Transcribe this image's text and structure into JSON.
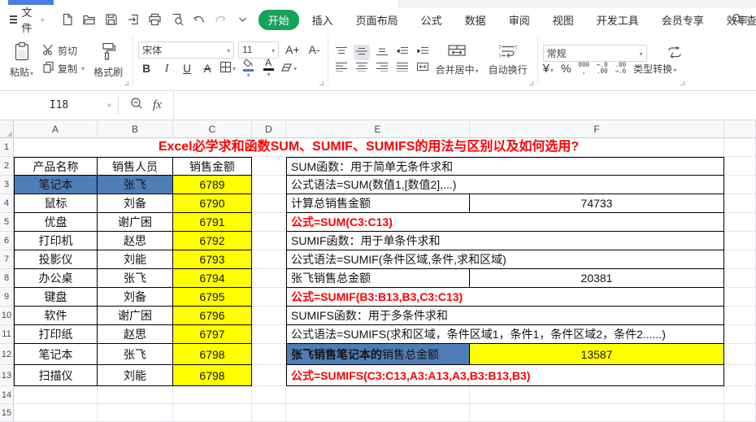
{
  "menu": {
    "file_label": "文件",
    "quick_icons": [
      "new-file",
      "open-folder",
      "save",
      "export",
      "print",
      "print-preview",
      "undo",
      "redo",
      "more"
    ],
    "tabs": [
      {
        "id": "home",
        "label": "开始",
        "active": true
      },
      {
        "id": "insert",
        "label": "插入"
      },
      {
        "id": "page-layout",
        "label": "页面布局"
      },
      {
        "id": "formulas",
        "label": "公式"
      },
      {
        "id": "data",
        "label": "数据"
      },
      {
        "id": "review",
        "label": "审阅"
      },
      {
        "id": "view",
        "label": "视图"
      },
      {
        "id": "dev-tools",
        "label": "开发工具"
      },
      {
        "id": "member",
        "label": "会员专享"
      },
      {
        "id": "efficiency",
        "label": "效率"
      }
    ],
    "search_label": "查找"
  },
  "ribbon": {
    "paste_label": "粘贴",
    "cut_label": "剪切",
    "copy_label": "复制",
    "format_painter_label": "格式刷",
    "font_name": "宋体",
    "font_size": "11",
    "grow_font_label": "A+",
    "shrink_font_label": "A-",
    "bold_label": "B",
    "italic_label": "I",
    "underline_label": "U",
    "strikethrough_label": "A",
    "font_color_label": "A",
    "merge_center_label": "合并居中",
    "wrap_label": "自动换行",
    "number_format": "常规",
    "currency_label": "¥",
    "percent_label": "%",
    "thousands_top": "000",
    "thousands_bottom": ",",
    "dec_decimal_top": "←.0",
    "dec_decimal_bottom": ".00",
    "inc_decimal_top": ".00",
    "inc_decimal_bottom": "→.0",
    "type_convert_label": "类型转换"
  },
  "formula_bar": {
    "name_box": "I18",
    "fx_label": "fx",
    "formula_value": ""
  },
  "sheet": {
    "title": "Excel必学求和函数SUM、SUMIF、SUMIFS的用法与区别以及如何选用?",
    "col_headers": [
      "A",
      "B",
      "C",
      "D",
      "E",
      "F"
    ],
    "rows": [
      {
        "num": 1,
        "type": "title"
      },
      {
        "num": 2,
        "left": [
          "产品名称",
          "销售人员",
          "销售金额"
        ],
        "left_type": "header",
        "right": {
          "kind": "full",
          "text": "SUM函数：用于简单无条件求和"
        }
      },
      {
        "num": 3,
        "left": [
          "笔记本",
          "张飞",
          "6789"
        ],
        "selected": true,
        "right": {
          "kind": "full",
          "text": "公式语法=SUM(数值1,[数值2],...)"
        }
      },
      {
        "num": 4,
        "left": [
          "鼠标",
          "刘备",
          "6790"
        ],
        "right": {
          "kind": "split",
          "label": "计算总销售金额",
          "value": "74733"
        }
      },
      {
        "num": 5,
        "left": [
          "优盘",
          "谢广困",
          "6791"
        ],
        "right": {
          "kind": "formula",
          "text": "公式=SUM(C3:C13)"
        }
      },
      {
        "num": 6,
        "left": [
          "打印机",
          "赵思",
          "6792"
        ],
        "right": {
          "kind": "full",
          "text": "SUMIF函数：用于单条件求和"
        }
      },
      {
        "num": 7,
        "left": [
          "投影仪",
          "刘能",
          "6793"
        ],
        "right": {
          "kind": "full",
          "text": "公式语法=SUMIF(条件区域,条件,求和区域)"
        }
      },
      {
        "num": 8,
        "left": [
          "办公桌",
          "张飞",
          "6794"
        ],
        "right": {
          "kind": "split",
          "label": "张飞销售总金额",
          "value": "20381"
        }
      },
      {
        "num": 9,
        "left": [
          "键盘",
          "刘备",
          "6795"
        ],
        "right": {
          "kind": "formula",
          "text": "公式=SUMIF(B3:B13,B3,C3:C13)"
        }
      },
      {
        "num": 10,
        "left": [
          "软件",
          "谢广困",
          "6796"
        ],
        "right": {
          "kind": "full",
          "text": "SUMIFS函数：用于多条件求和"
        }
      },
      {
        "num": 11,
        "left": [
          "打印纸",
          "赵思",
          "6797"
        ],
        "right": {
          "kind": "full",
          "text": "公式语法=SUMIFS(求和区域，条件区域1，条件1，条件区域2，条件2......)"
        }
      },
      {
        "num": 12,
        "left": [
          "笔记本",
          "张飞",
          "6798"
        ],
        "right": {
          "kind": "split2",
          "label_bold": "张飞销售笔记本的",
          "label_rest": "销售总金额",
          "value": "13587"
        }
      },
      {
        "num": 13,
        "left": [
          "扫描仪",
          "刘能",
          "6798"
        ],
        "right": {
          "kind": "formula",
          "text": "公式=SUMIFS(C3:C13,A3:A13,A3,B3:B13,B3)"
        }
      },
      {
        "num": 14
      },
      {
        "num": 15
      }
    ]
  },
  "colors": {
    "selection_blue": "#4f7db6",
    "highlight_yellow": "#ffff00",
    "accent_red": "#fe0000",
    "active_tab_green": "#17a25a",
    "doc_tab_blue": "#4c7be1"
  }
}
